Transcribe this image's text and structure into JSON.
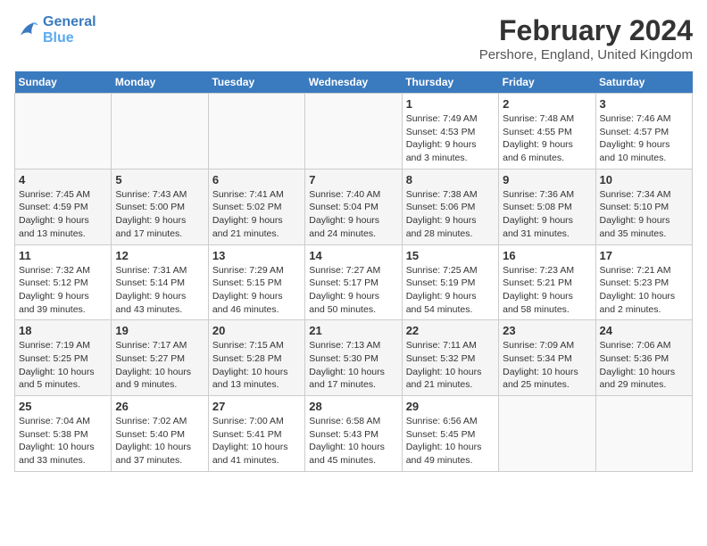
{
  "header": {
    "logo_line1": "General",
    "logo_line2": "Blue",
    "month_title": "February 2024",
    "location": "Pershore, England, United Kingdom"
  },
  "weekdays": [
    "Sunday",
    "Monday",
    "Tuesday",
    "Wednesday",
    "Thursday",
    "Friday",
    "Saturday"
  ],
  "weeks": [
    [
      {
        "day": "",
        "info": ""
      },
      {
        "day": "",
        "info": ""
      },
      {
        "day": "",
        "info": ""
      },
      {
        "day": "",
        "info": ""
      },
      {
        "day": "1",
        "info": "Sunrise: 7:49 AM\nSunset: 4:53 PM\nDaylight: 9 hours\nand 3 minutes."
      },
      {
        "day": "2",
        "info": "Sunrise: 7:48 AM\nSunset: 4:55 PM\nDaylight: 9 hours\nand 6 minutes."
      },
      {
        "day": "3",
        "info": "Sunrise: 7:46 AM\nSunset: 4:57 PM\nDaylight: 9 hours\nand 10 minutes."
      }
    ],
    [
      {
        "day": "4",
        "info": "Sunrise: 7:45 AM\nSunset: 4:59 PM\nDaylight: 9 hours\nand 13 minutes."
      },
      {
        "day": "5",
        "info": "Sunrise: 7:43 AM\nSunset: 5:00 PM\nDaylight: 9 hours\nand 17 minutes."
      },
      {
        "day": "6",
        "info": "Sunrise: 7:41 AM\nSunset: 5:02 PM\nDaylight: 9 hours\nand 21 minutes."
      },
      {
        "day": "7",
        "info": "Sunrise: 7:40 AM\nSunset: 5:04 PM\nDaylight: 9 hours\nand 24 minutes."
      },
      {
        "day": "8",
        "info": "Sunrise: 7:38 AM\nSunset: 5:06 PM\nDaylight: 9 hours\nand 28 minutes."
      },
      {
        "day": "9",
        "info": "Sunrise: 7:36 AM\nSunset: 5:08 PM\nDaylight: 9 hours\nand 31 minutes."
      },
      {
        "day": "10",
        "info": "Sunrise: 7:34 AM\nSunset: 5:10 PM\nDaylight: 9 hours\nand 35 minutes."
      }
    ],
    [
      {
        "day": "11",
        "info": "Sunrise: 7:32 AM\nSunset: 5:12 PM\nDaylight: 9 hours\nand 39 minutes."
      },
      {
        "day": "12",
        "info": "Sunrise: 7:31 AM\nSunset: 5:14 PM\nDaylight: 9 hours\nand 43 minutes."
      },
      {
        "day": "13",
        "info": "Sunrise: 7:29 AM\nSunset: 5:15 PM\nDaylight: 9 hours\nand 46 minutes."
      },
      {
        "day": "14",
        "info": "Sunrise: 7:27 AM\nSunset: 5:17 PM\nDaylight: 9 hours\nand 50 minutes."
      },
      {
        "day": "15",
        "info": "Sunrise: 7:25 AM\nSunset: 5:19 PM\nDaylight: 9 hours\nand 54 minutes."
      },
      {
        "day": "16",
        "info": "Sunrise: 7:23 AM\nSunset: 5:21 PM\nDaylight: 9 hours\nand 58 minutes."
      },
      {
        "day": "17",
        "info": "Sunrise: 7:21 AM\nSunset: 5:23 PM\nDaylight: 10 hours\nand 2 minutes."
      }
    ],
    [
      {
        "day": "18",
        "info": "Sunrise: 7:19 AM\nSunset: 5:25 PM\nDaylight: 10 hours\nand 5 minutes."
      },
      {
        "day": "19",
        "info": "Sunrise: 7:17 AM\nSunset: 5:27 PM\nDaylight: 10 hours\nand 9 minutes."
      },
      {
        "day": "20",
        "info": "Sunrise: 7:15 AM\nSunset: 5:28 PM\nDaylight: 10 hours\nand 13 minutes."
      },
      {
        "day": "21",
        "info": "Sunrise: 7:13 AM\nSunset: 5:30 PM\nDaylight: 10 hours\nand 17 minutes."
      },
      {
        "day": "22",
        "info": "Sunrise: 7:11 AM\nSunset: 5:32 PM\nDaylight: 10 hours\nand 21 minutes."
      },
      {
        "day": "23",
        "info": "Sunrise: 7:09 AM\nSunset: 5:34 PM\nDaylight: 10 hours\nand 25 minutes."
      },
      {
        "day": "24",
        "info": "Sunrise: 7:06 AM\nSunset: 5:36 PM\nDaylight: 10 hours\nand 29 minutes."
      }
    ],
    [
      {
        "day": "25",
        "info": "Sunrise: 7:04 AM\nSunset: 5:38 PM\nDaylight: 10 hours\nand 33 minutes."
      },
      {
        "day": "26",
        "info": "Sunrise: 7:02 AM\nSunset: 5:40 PM\nDaylight: 10 hours\nand 37 minutes."
      },
      {
        "day": "27",
        "info": "Sunrise: 7:00 AM\nSunset: 5:41 PM\nDaylight: 10 hours\nand 41 minutes."
      },
      {
        "day": "28",
        "info": "Sunrise: 6:58 AM\nSunset: 5:43 PM\nDaylight: 10 hours\nand 45 minutes."
      },
      {
        "day": "29",
        "info": "Sunrise: 6:56 AM\nSunset: 5:45 PM\nDaylight: 10 hours\nand 49 minutes."
      },
      {
        "day": "",
        "info": ""
      },
      {
        "day": "",
        "info": ""
      }
    ]
  ]
}
